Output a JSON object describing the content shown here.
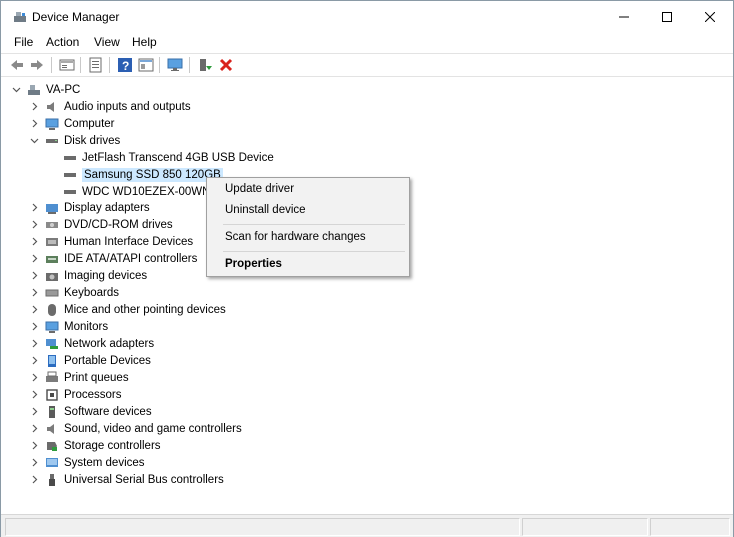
{
  "window": {
    "title": "Device Manager"
  },
  "menu": {
    "file": "File",
    "action": "Action",
    "view": "View",
    "help": "Help"
  },
  "toolbar": [
    "back-arrow-icon",
    "forward-arrow-icon",
    "properties-icon",
    "update-icon",
    "help-icon",
    "view-icon",
    "monitor-icon",
    "enable-device-icon",
    "uninstall-x-icon"
  ],
  "tree": {
    "root": "VA-PC",
    "categories": {
      "audio": "Audio inputs and outputs",
      "computer": "Computer",
      "disk": "Disk drives",
      "display": "Display adapters",
      "dvd": "DVD/CD-ROM drives",
      "hid": "Human Interface Devices",
      "ide": "IDE ATA/ATAPI controllers",
      "imaging": "Imaging devices",
      "keyboards": "Keyboards",
      "mice": "Mice and other pointing devices",
      "monitors": "Monitors",
      "network": "Network adapters",
      "portable": "Portable Devices",
      "print": "Print queues",
      "processors": "Processors",
      "software": "Software devices",
      "sound": "Sound, video and game controllers",
      "storage": "Storage controllers",
      "system": "System devices",
      "usb": "Universal Serial Bus controllers"
    },
    "disk_children": [
      "JetFlash Transcend 4GB USB Device",
      "Samsung SSD 850 120GB",
      "WDC WD10EZEX-00WN"
    ],
    "selected_index": 1
  },
  "context_menu": {
    "update": "Update driver",
    "uninstall": "Uninstall device",
    "scan": "Scan for hardware changes",
    "properties": "Properties"
  },
  "colors": {
    "selection": "#cce8ff",
    "accent": "#1f6fc5",
    "delete": "#d9221c"
  }
}
